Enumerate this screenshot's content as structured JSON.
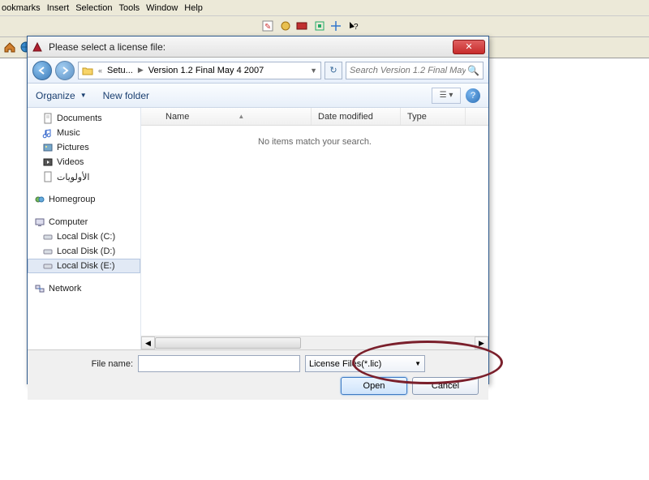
{
  "menubar": {
    "items": [
      "ookmarks",
      "Insert",
      "Selection",
      "Tools",
      "Window",
      "Help"
    ]
  },
  "dialog": {
    "title": "Please select a license file:",
    "breadcrumb": {
      "folder1": "Setu...",
      "folder2": "Version 1.2 Final May 4 2007"
    },
    "search_placeholder": "Search Version 1.2 Final May 4...",
    "organize_label": "Organize",
    "newfolder_label": "New folder",
    "columns": {
      "name": "Name",
      "date": "Date modified",
      "type": "Type"
    },
    "empty_message": "No items match your search.",
    "filename_label": "File name:",
    "filename_value": "",
    "filter_label": "License Files(*.lic)",
    "open_label": "Open",
    "cancel_label": "Cancel"
  },
  "nav": {
    "documents": "Documents",
    "music": "Music",
    "pictures": "Pictures",
    "videos": "Videos",
    "priorities_ar": "الأولويات",
    "homegroup": "Homegroup",
    "computer": "Computer",
    "localc": "Local Disk (C:)",
    "locald": "Local Disk (D:)",
    "locale": "Local Disk (E:)",
    "network": "Network"
  }
}
